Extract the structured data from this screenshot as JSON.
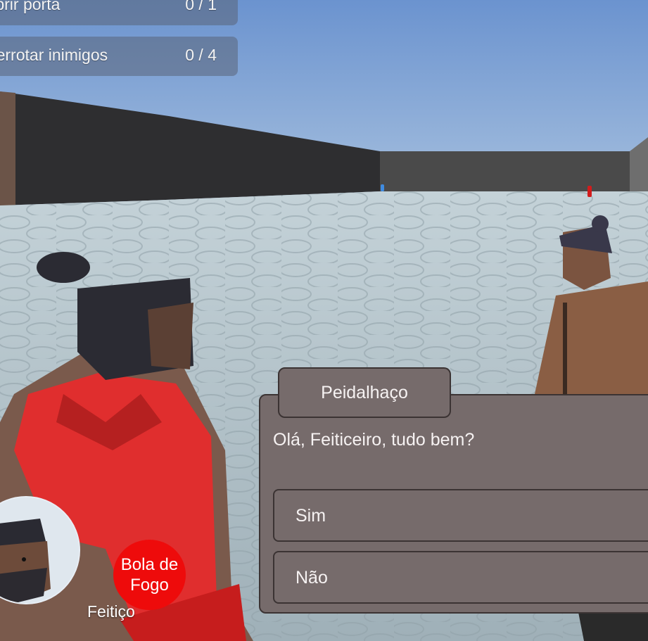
{
  "quests": [
    {
      "label": "Abrir porta",
      "progress": "0 / 1"
    },
    {
      "label": "Derrotar inimigos",
      "progress": "0 / 4"
    }
  ],
  "dialog": {
    "speaker": "Peidalhaço",
    "text": "Olá, Feiticeiro, tudo bem?",
    "choices": [
      "Sim",
      "Não"
    ]
  },
  "hud": {
    "spell_name": "Bola de Fogo",
    "spell_name_line1": "Bola de",
    "spell_name_line2": "Fogo",
    "spell_type": "Feitiço"
  },
  "colors": {
    "spell_button": "#ee0b0b",
    "dialog_panel": "#766b6b",
    "sky": "#7fa3d6"
  }
}
